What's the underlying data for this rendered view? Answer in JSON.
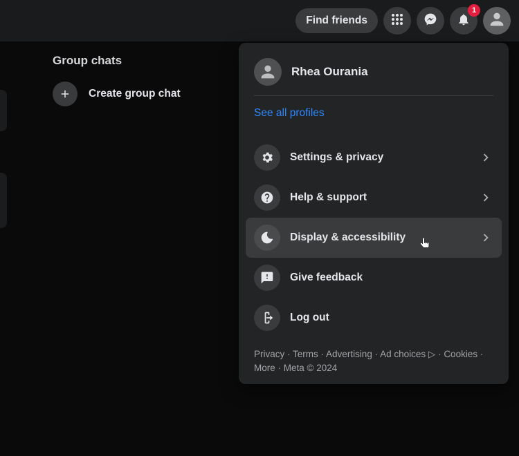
{
  "topbar": {
    "find_friends": "Find friends",
    "notif_count": "1"
  },
  "sidebar": {
    "title": "Group chats",
    "create_label": "Create group chat"
  },
  "panel": {
    "profile_name": "Rhea Ourania",
    "see_all": "See all profiles",
    "menu": [
      {
        "label": "Settings & privacy",
        "has_chevron": true
      },
      {
        "label": "Help & support",
        "has_chevron": true
      },
      {
        "label": "Display & accessibility",
        "has_chevron": true
      },
      {
        "label": "Give feedback",
        "has_chevron": false
      },
      {
        "label": "Log out",
        "has_chevron": false
      }
    ],
    "footer": {
      "privacy": "Privacy",
      "terms": "Terms",
      "advertising": "Advertising",
      "ad_choices": "Ad choices",
      "cookies": "Cookies",
      "more": "More",
      "copyright": "Meta © 2024"
    }
  }
}
